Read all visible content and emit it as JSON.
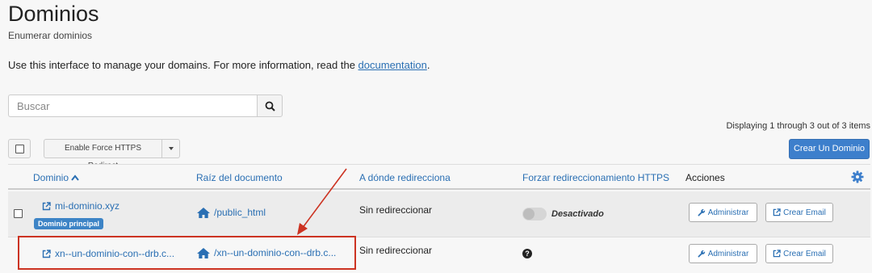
{
  "page": {
    "title": "Dominios",
    "subtitle": "Enumerar dominios",
    "intro_text": "Use this interface to manage your domains. For more information, read the ",
    "intro_link": "documentation",
    "intro_end": "."
  },
  "search": {
    "placeholder": "Buscar",
    "value": ""
  },
  "pagination": {
    "displaying": "Displaying 1 through 3 out of 3 items"
  },
  "toolbar": {
    "https_redirect_label": "Enable Force HTTPS Redirect",
    "create_label": "Crear Un Dominio"
  },
  "table": {
    "columns": {
      "domain": "Dominio",
      "docroot": "Raíz del documento",
      "redirect": "A dónde redirecciona",
      "force_https": "Forzar redireccionamiento HTTPS",
      "actions": "Acciones"
    },
    "rows": [
      {
        "domain": "mi-dominio.xyz",
        "badge": "Dominio principal",
        "docroot": "/public_html",
        "redirect": "Sin redireccionar",
        "force_https": "Desactivado",
        "manage": "Administrar",
        "email": "Crear Email"
      },
      {
        "domain": "xn--un-dominio-con--drb.c...",
        "docroot": "/xn--un-dominio-con--drb.c...",
        "redirect": "Sin redireccionar",
        "force_https_icon": "question-circle-icon",
        "manage": "Administrar",
        "email": "Crear Email"
      }
    ]
  },
  "colors": {
    "link": "#2a6fb3",
    "primary_button": "#3d7fcc",
    "badge": "#3d84c6",
    "annotation": "#cc3322"
  }
}
